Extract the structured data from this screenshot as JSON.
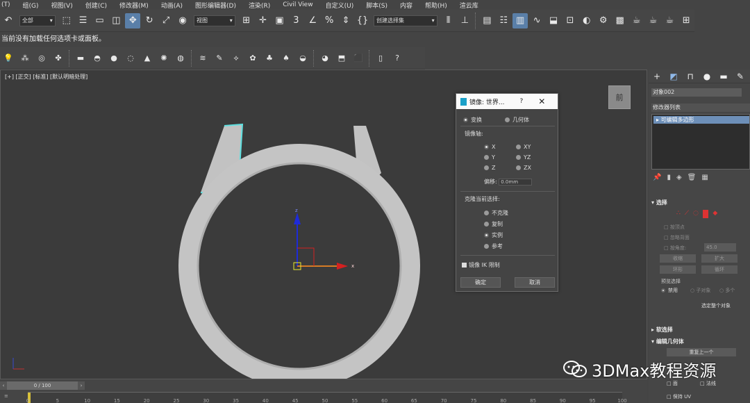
{
  "menu": [
    "(T)",
    "组(G)",
    "视图(V)",
    "创建(C)",
    "修改器(M)",
    "动画(A)",
    "图形编辑器(D)",
    "渲染(R)",
    "Civil View",
    "自定义(U)",
    "脚本(S)",
    "内容",
    "帮助(H)",
    "渲云库"
  ],
  "toolbar": {
    "filter_value": "全部",
    "refcoord_value": "视图",
    "selset_placeholder": "创建选择集"
  },
  "hint": "当前没有加载任何选项卡或面板。",
  "viewport": {
    "label": "[+] [正交] [标准] [默认明暗处理]",
    "viewcube_label": "前",
    "axis_x": "x",
    "axis_z": "z"
  },
  "dialog": {
    "title": "镜像: 世界...",
    "help": "?",
    "close": "✕",
    "mode_transform": "变换",
    "mode_geometry": "几何体",
    "mirror_axis_label": "镜像轴:",
    "axes": [
      "X",
      "Y",
      "Z",
      "XY",
      "YZ",
      "ZX"
    ],
    "offset_label": "偏移:",
    "offset_value": "0.0mm",
    "clone_label": "克隆当前选择:",
    "clone_options": [
      "不克隆",
      "复制",
      "实例",
      "参考"
    ],
    "mirror_ik": "镜像 IK 限制",
    "ok": "确定",
    "cancel": "取消"
  },
  "command_panel": {
    "object_name": "对象002",
    "modifier_list": "修改器列表",
    "modifier_item": "可编辑多边形",
    "selection_title": "选择",
    "by_vertex": "按顶点",
    "ignore_backfacing": "忽略背面",
    "by_angle": "按角度:",
    "angle_value": "45.0",
    "shrink": "收缩",
    "grow": "扩大",
    "ring": "环形",
    "loop": "循环",
    "preview_title": "预览选择",
    "preview_disabled": "禁用",
    "preview_subobj": "子对象",
    "preview_multi": "多个",
    "select_whole": "选定整个对象",
    "soft_selection": "软选择",
    "edit_geometry": "编辑几何体",
    "repeat_last": "重复上一个",
    "face": "面",
    "edge": "法线",
    "preserve_uv": "保持 UV"
  },
  "timeline": {
    "slider": "0 / 100",
    "ticks": [
      "0",
      "5",
      "10",
      "15",
      "20",
      "25",
      "30",
      "35",
      "40",
      "45",
      "50",
      "55",
      "60",
      "65",
      "70",
      "75",
      "80",
      "85",
      "90",
      "95",
      "100"
    ]
  },
  "watermark": "3DMax教程资源",
  "colors": {
    "accent": "#5a7fa8",
    "selected_modifier": "#6d8fb8",
    "cyan_edge": "#5fe0e0"
  }
}
